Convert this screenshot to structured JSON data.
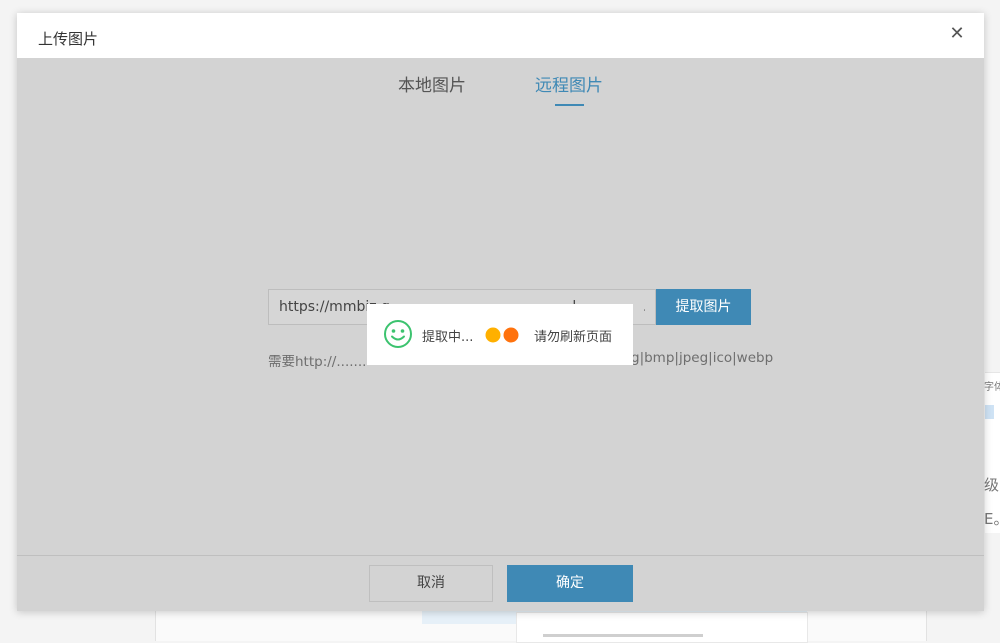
{
  "dialog": {
    "title": "上传图片",
    "close_label": "✕",
    "tabs": [
      {
        "label": "本地图片",
        "active": false
      },
      {
        "label": "远程图片",
        "active": true
      }
    ],
    "url_input": {
      "value": "https://mmbiz.q                    ...         ...      l...  ...  ...  ...:cPo"
    },
    "fetch_button": "提取图片",
    "hint_left": "需要http://.......",
    "hint_right": "g|bmp|jpeg|ico|webp",
    "cancel_button": "取消",
    "ok_button": "确定",
    "accent_color": "#3f89b5"
  },
  "toast": {
    "icon": "smile-icon",
    "loading_text": "提取中...",
    "refresh_text": "请勿刷新页面",
    "dot_colors": [
      "#ffb000",
      "#ff6a00"
    ]
  },
  "background": {
    "right_text_1": "字体",
    "right_text_2": "级",
    "right_text_3": "E。"
  }
}
